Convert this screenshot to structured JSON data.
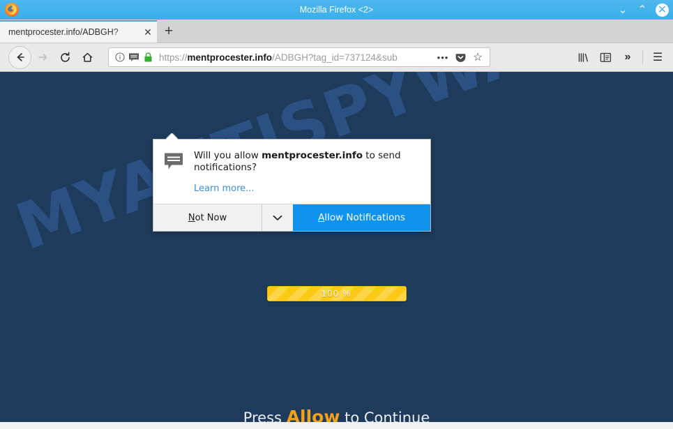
{
  "window": {
    "title": "Mozilla Firefox <2>",
    "logo_icon": "firefox-logo-icon",
    "minimize_label": "⌄",
    "maximize_label": "⌃",
    "close_label": "✕"
  },
  "tabs": {
    "items": [
      {
        "title": "mentprocester.info/ADBGH?",
        "close_label": "✕"
      }
    ],
    "new_tab_label": "+"
  },
  "navbar": {
    "back_label": "←",
    "forward_label": "→",
    "reload_label": "↻",
    "home_label": "⌂",
    "library_label": "library-icon",
    "sidebar_label": "sidebar-icon",
    "overflow_label": "»",
    "menu_label": "☰"
  },
  "urlbar": {
    "scheme": "https://",
    "host": "mentprocester.info",
    "path": "/ADBGH?tag_id=737124&sub",
    "full_url": "https://mentprocester.info/ADBGH?tag_id=737124&sub",
    "identity_icon": "info-icon",
    "notification_icon": "speech-bubble-icon",
    "lock_icon": "padlock-icon",
    "lock_color": "#35b035",
    "page_actions_label": "•••",
    "pocket_label": "pocket-icon",
    "bookmark_label": "☆"
  },
  "notification_popup": {
    "icon": "speech-bubble-icon",
    "question_prefix": "Will you allow ",
    "question_host": "mentprocester.info",
    "question_suffix": " to send notifications?",
    "learn_more": "Learn more...",
    "not_now_label": "Not Now",
    "not_now_accesskey": "N",
    "dropdown_label": "⌄",
    "allow_label": "Allow Notifications",
    "allow_accesskey": "A",
    "allow_button_color": "#1093ec"
  },
  "page": {
    "background_color": "#1e3b5c",
    "watermark_text": "MYANTISPYWARE.COM",
    "watermark_color": "#2b5183",
    "progress": {
      "percent_label": "100 %",
      "percent_value": 100,
      "bar_color": "#fbc916"
    },
    "cta": {
      "prefix": "Press ",
      "highlight": "Allow",
      "suffix": " to Continue",
      "highlight_color": "#f0a21c"
    }
  }
}
